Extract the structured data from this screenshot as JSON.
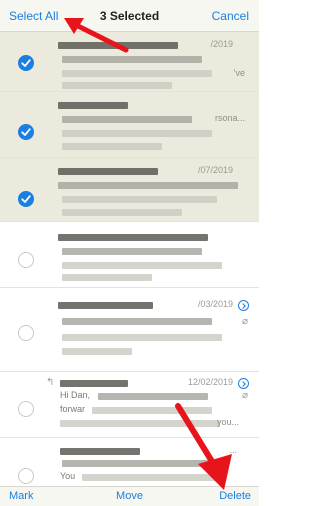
{
  "navbar": {
    "select_all_label": "Select All",
    "title": "3 Selected",
    "cancel_label": "Cancel"
  },
  "emails": [
    {
      "selected": true,
      "date": "/2019",
      "snippet": "'ve"
    },
    {
      "selected": true,
      "date": "",
      "snippet": "rsona..."
    },
    {
      "selected": true,
      "date": "/07/2019",
      "snippet": ""
    },
    {
      "selected": false,
      "date": "",
      "snippet": ""
    },
    {
      "selected": false,
      "date": "/03/2019",
      "snippet": ""
    },
    {
      "selected": false,
      "date": "12/02/2019",
      "snippet": "...",
      "preview": "Hi Dan,",
      "preview2": "forwar",
      "preview3": "you..."
    },
    {
      "selected": false,
      "date": "",
      "snippet": "...",
      "preview": "You"
    }
  ],
  "toolbar": {
    "mark_label": "Mark",
    "move_label": "Move",
    "delete_label": "Delete"
  },
  "colors": {
    "accent": "#1a7fe0",
    "selected_row": "#eceadc",
    "annotation": "#e8141c"
  }
}
